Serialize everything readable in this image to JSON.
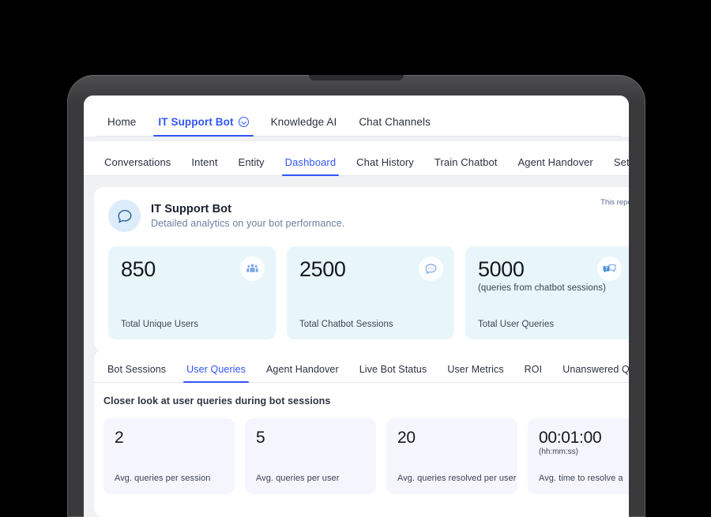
{
  "product_nav": {
    "items": [
      {
        "label": "Home",
        "active": false,
        "icon": null
      },
      {
        "label": "IT Support Bot",
        "active": true,
        "icon": "chevron-down-circle-icon"
      },
      {
        "label": "Knowledge AI",
        "active": false,
        "icon": null
      },
      {
        "label": "Chat Channels",
        "active": false,
        "icon": null
      }
    ]
  },
  "section_nav": {
    "items": [
      {
        "label": "Conversations",
        "active": false
      },
      {
        "label": "Intent",
        "active": false
      },
      {
        "label": "Entity",
        "active": false
      },
      {
        "label": "Dashboard",
        "active": true
      },
      {
        "label": "Chat History",
        "active": false
      },
      {
        "label": "Train Chatbot",
        "active": false
      },
      {
        "label": "Agent Handover",
        "active": false
      },
      {
        "label": "Settings",
        "active": false
      }
    ]
  },
  "overview": {
    "bot_icon": "chat-bubble-icon",
    "title": "IT Support Bot",
    "subtitle": "Detailed analytics on your bot performance.",
    "report_note": "This report w",
    "kpi_cards": [
      {
        "value": "850",
        "sub": "",
        "label": "Total Unique Users",
        "icon": "users-group-icon",
        "bg": "#e8f6fb"
      },
      {
        "value": "2500",
        "sub": "",
        "label": "Total Chatbot Sessions",
        "icon": "chat-bubble-dots-icon",
        "bg": "#e8f6fb"
      },
      {
        "value": "5000",
        "sub": "(queries from chatbot sessions)",
        "label": "Total User Queries",
        "icon": "chat-question-icon",
        "bg": "#e8f6fb"
      }
    ]
  },
  "detail": {
    "metric_nav": [
      {
        "label": "Bot Sessions",
        "active": false
      },
      {
        "label": "User Queries",
        "active": true
      },
      {
        "label": "Agent Handover",
        "active": false
      },
      {
        "label": "Live Bot Status",
        "active": false
      },
      {
        "label": "User Metrics",
        "active": false
      },
      {
        "label": "ROI",
        "active": false
      },
      {
        "label": "Unanswered Queries",
        "active": false
      }
    ],
    "heading": "Closer look at user queries during bot sessions",
    "metric_cards": [
      {
        "value": "2",
        "unit": "",
        "label": "Avg. queries per session"
      },
      {
        "value": "5",
        "unit": "",
        "label": "Avg. queries per user"
      },
      {
        "value": "20",
        "unit": "",
        "label": "Avg. queries resolved per user"
      },
      {
        "value": "00:01:00",
        "unit": "(hh:mm:ss)",
        "label": "Avg. time to resolve a"
      }
    ]
  },
  "theme": {
    "accent_blue": "#3056f5",
    "kpi_card_bg": "#e8f6fb",
    "metric_card_bg": "#f4f5fd",
    "page_bg": "#f0f1f3",
    "bezel": "#3a3a3c",
    "icon_blue": "#7da7e8"
  }
}
